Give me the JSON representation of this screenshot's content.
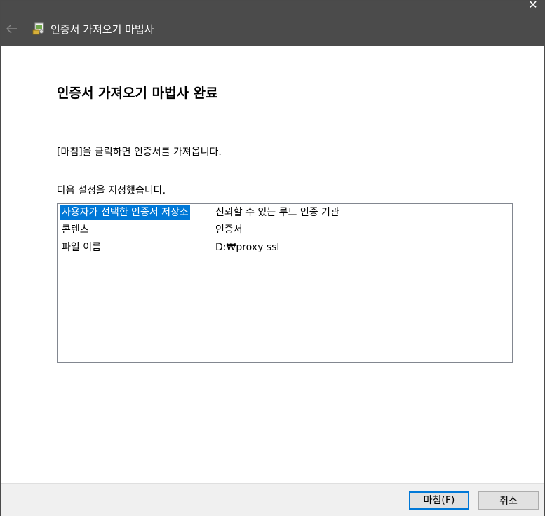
{
  "window": {
    "title": "인증서 가져오기 마법사",
    "close_glyph": "✕",
    "back_glyph": "←"
  },
  "page": {
    "heading": "인증서 가져오기 마법사 완료",
    "instruction": "[마침]을 클릭하면 인증서를 가져옵니다.",
    "settings_label": "다음 설정을 지정했습니다."
  },
  "settings": [
    {
      "key": "사용자가 선택한 인증서 저장소",
      "value": "신뢰할 수 있는 루트 인증 기관",
      "selected": true
    },
    {
      "key": "콘텐츠",
      "value": "인증서",
      "selected": false
    },
    {
      "key": "파일 이름",
      "value": "D:₩proxy ssl",
      "selected": false
    }
  ],
  "buttons": {
    "finish": "마침(F)",
    "cancel": "취소"
  },
  "colors": {
    "titlebar": "#4b4b4b",
    "selection": "#0078d7",
    "footer": "#f0f0f0"
  },
  "icons": {
    "back": "arrow-left-icon",
    "app": "certificate-import-icon",
    "close": "close-icon"
  }
}
